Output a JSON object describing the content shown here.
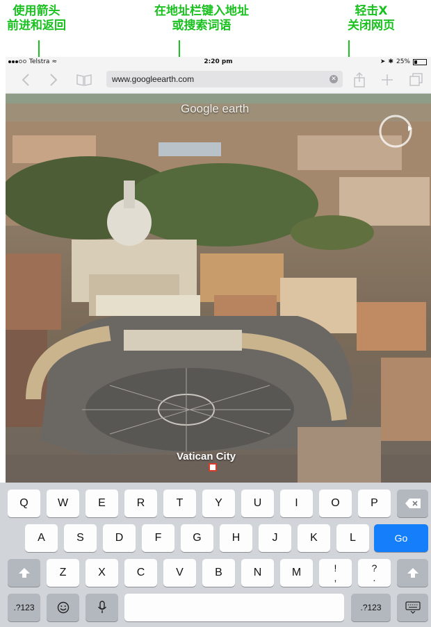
{
  "annotations": {
    "back_forward": [
      "使用箭头",
      "前进和返回"
    ],
    "address_bar": [
      "在地址栏键入地址",
      "或搜索词语"
    ],
    "close_tab": [
      "轻击X",
      "关闭网页"
    ]
  },
  "status_bar": {
    "carrier": "Telstra",
    "time": "2:20 pm",
    "battery": "25%"
  },
  "toolbar": {
    "url": "www.googleearth.com"
  },
  "map": {
    "watermark": "Google earth",
    "place_label": "Vatican City"
  },
  "keyboard": {
    "row1": [
      "Q",
      "W",
      "E",
      "R",
      "T",
      "Y",
      "U",
      "I",
      "O",
      "P"
    ],
    "row2": [
      "A",
      "S",
      "D",
      "F",
      "G",
      "H",
      "J",
      "K",
      "L"
    ],
    "row3": [
      "Z",
      "X",
      "C",
      "V",
      "B",
      "N",
      "M",
      "!",
      "?"
    ],
    "row3_sub": [
      ",",
      "."
    ],
    "go_label": "Go",
    "numbers_label": ".?123"
  },
  "colors": {
    "annotation": "#19c11f",
    "go_key": "#157efb"
  },
  "icons": {
    "back": "chevron-left-icon",
    "forward": "chevron-right-icon",
    "bookmarks": "book-icon",
    "share": "share-icon",
    "new_tab": "plus-icon",
    "tabs": "tabs-icon",
    "delete": "backspace-icon",
    "shift": "shift-icon",
    "emoji": "emoji-icon",
    "mic": "microphone-icon",
    "hide_keyboard": "keyboard-icon"
  }
}
